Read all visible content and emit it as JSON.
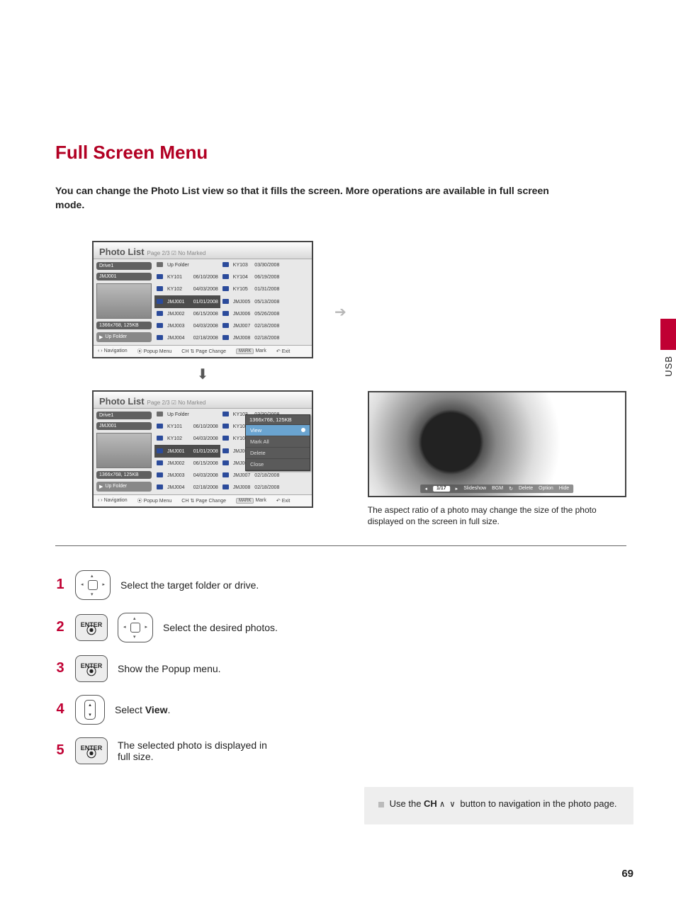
{
  "sidebar": {
    "label": "USB"
  },
  "headings": {
    "h1": "Full Screen Menu"
  },
  "intro": "You can change the Photo List view so that it fills the screen. More operations are available in full screen mode.",
  "photo_list": {
    "title": "Photo List",
    "page_info": "Page 2/3",
    "marked": "No Marked",
    "drive": "Drive1",
    "selected": "JMJ001",
    "selected_info": "1366x768, 125KB",
    "up_folder": "Up Folder",
    "col1": [
      {
        "name": "Up Folder",
        "date": "",
        "type": "folder"
      },
      {
        "name": "KY101",
        "date": "06/10/2008",
        "type": "pic"
      },
      {
        "name": "KY102",
        "date": "04/03/2008",
        "type": "pic"
      },
      {
        "name": "JMJ001",
        "date": "01/01/2008",
        "type": "pic",
        "sel": true
      },
      {
        "name": "JMJ002",
        "date": "06/15/2008",
        "type": "pic"
      },
      {
        "name": "JMJ003",
        "date": "04/03/2008",
        "type": "pic"
      },
      {
        "name": "JMJ004",
        "date": "02/18/2008",
        "type": "pic"
      }
    ],
    "col2": [
      {
        "name": "KY103",
        "date": "03/30/2008",
        "type": "pic"
      },
      {
        "name": "KY104",
        "date": "06/19/2008",
        "type": "pic"
      },
      {
        "name": "KY105",
        "date": "01/31/2008",
        "type": "pic"
      },
      {
        "name": "JMJ005",
        "date": "05/13/2008",
        "type": "pic"
      },
      {
        "name": "JMJ006",
        "date": "05/26/2008",
        "type": "pic"
      },
      {
        "name": "JMJ007",
        "date": "02/18/2008",
        "type": "pic"
      },
      {
        "name": "JMJ008",
        "date": "02/18/2008",
        "type": "pic"
      }
    ],
    "hints": {
      "nav": "Navigation",
      "popup": "Popup Menu",
      "ch": "CH",
      "page": "Page Change",
      "mark_btn": "MARK",
      "mark": "Mark",
      "exit": "Exit"
    }
  },
  "popup": {
    "header": "1366x768, 125KB",
    "view": "View",
    "mark_all": "Mark All",
    "delete": "Delete",
    "close": "Close"
  },
  "preview": {
    "counter": "1/17",
    "items": [
      "Slideshow",
      "BGM",
      "Delete",
      "Option",
      "Hide"
    ],
    "caption": "The aspect ratio of a photo may change the size of the photo displayed on the screen in full size."
  },
  "enter_label": "ENTER",
  "steps": {
    "s1": "Select the target folder or drive.",
    "s2": "Select the desired photos.",
    "s3": "Show the Popup menu.",
    "s4_a": "Select ",
    "s4_b": "View",
    "s4_c": ".",
    "s5": "The selected photo is displayed in full size."
  },
  "tip": {
    "pre": "Use the ",
    "ch": "CH",
    "post": " button to navigation in the photo page."
  },
  "page_number": "69"
}
